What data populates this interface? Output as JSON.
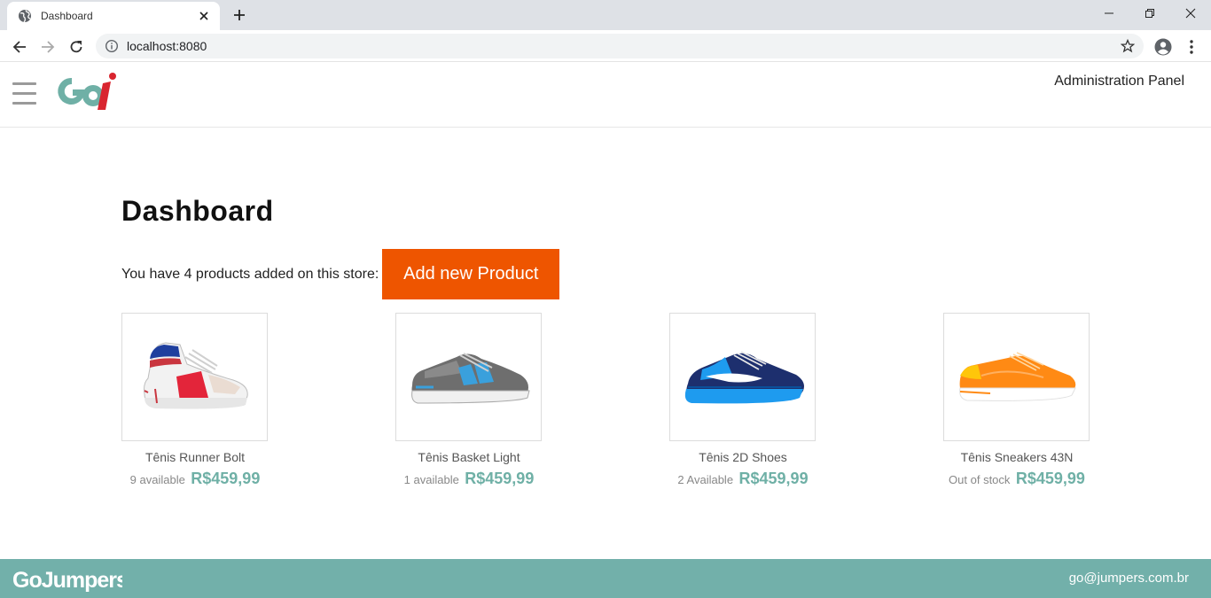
{
  "browser": {
    "tab_title": "Dashboard",
    "url": "localhost:8080"
  },
  "header": {
    "admin_link": "Administration Panel"
  },
  "main": {
    "title": "Dashboard",
    "products_text": "You have 4 products added on this store:",
    "add_button": "Add new Product"
  },
  "products": [
    {
      "name": "Tênis Runner Bolt",
      "stock": "9 available",
      "price": "R$459,99"
    },
    {
      "name": "Tênis Basket Light",
      "stock": "1 available",
      "price": "R$459,99"
    },
    {
      "name": "Tênis 2D Shoes",
      "stock": "2 Available",
      "price": "R$459,99"
    },
    {
      "name": "Tênis Sneakers 43N",
      "stock": "Out of stock",
      "price": "R$459,99"
    }
  ],
  "footer": {
    "email": "go@jumpers.com.br"
  },
  "colors": {
    "accent_orange": "#ee5500",
    "teal": "#72b0aa",
    "price_teal": "#6fb0a6",
    "logo_red": "#d9252f"
  }
}
